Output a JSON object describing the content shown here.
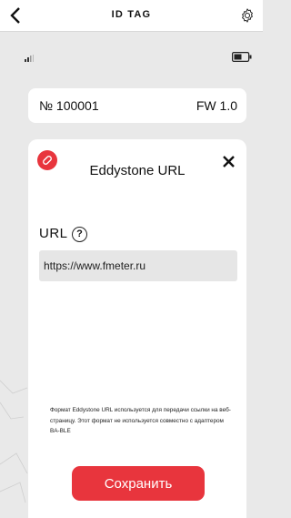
{
  "header": {
    "title": "ID TAG",
    "back_icon": "chevron-left-icon",
    "settings_icon": "gear-icon"
  },
  "status": {
    "signal_icon": "signal-icon",
    "battery_icon": "battery-icon"
  },
  "device": {
    "number": "№ 100001",
    "firmware": "FW 1.0"
  },
  "modal": {
    "icon": "link-icon",
    "title": "Eddystone URL",
    "close_icon": "close-icon",
    "url_label": "URL",
    "help_glyph": "?",
    "url_value": "https://www.fmeter.ru",
    "info": "Формат Eddystone URL используется для передачи ссылки на веб-страницу. Этот формат не используется совместно с адаптером BA-BLE",
    "save_label": "Сохранить"
  },
  "colors": {
    "accent": "#e8353d",
    "background": "#e9e9e9",
    "input": "#e6e6e6"
  }
}
